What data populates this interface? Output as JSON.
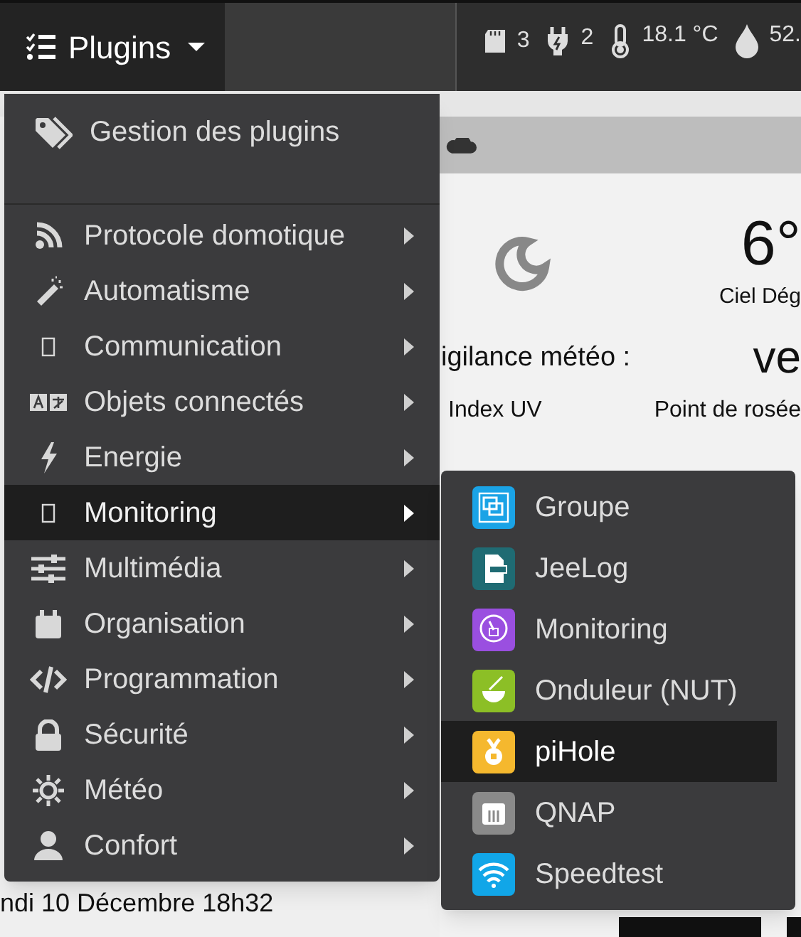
{
  "topbar": {
    "plugins_button": {
      "label": "Plugins"
    },
    "status": [
      {
        "value": "3"
      },
      {
        "value": "2"
      },
      {
        "value": "18.1 °C"
      },
      {
        "value": "52."
      }
    ]
  },
  "weather": {
    "temperature": "6°",
    "condition": "Ciel Dég",
    "vigilance_label": "igilance météo :",
    "vigilance_value": "ve",
    "columns": [
      "Index UV",
      "Point de rosée"
    ]
  },
  "footer_text": "ndi 10 Décembre 18h32",
  "menu": {
    "header": {
      "label": "Gestion des plugins"
    },
    "items": [
      {
        "label": "Protocole domotique",
        "selected": false
      },
      {
        "label": "Automatisme",
        "selected": false
      },
      {
        "label": "Communication",
        "selected": false
      },
      {
        "label": "Objets connectés",
        "selected": false
      },
      {
        "label": "Energie",
        "selected": false
      },
      {
        "label": "Monitoring",
        "selected": true
      },
      {
        "label": "Multimédia",
        "selected": false
      },
      {
        "label": "Organisation",
        "selected": false
      },
      {
        "label": "Programmation",
        "selected": false
      },
      {
        "label": "Sécurité",
        "selected": false
      },
      {
        "label": "Météo",
        "selected": false
      },
      {
        "label": "Confort",
        "selected": false
      }
    ]
  },
  "submenu": {
    "items": [
      {
        "label": "Groupe",
        "color": "#1aa3e6",
        "selected": false
      },
      {
        "label": "JeeLog",
        "color": "#1f6b73",
        "selected": false
      },
      {
        "label": "Monitoring",
        "color": "#9a4fe0",
        "selected": false
      },
      {
        "label": "Onduleur (NUT)",
        "color": "#8cbf26",
        "selected": false
      },
      {
        "label": "piHole",
        "color": "#f5b82e",
        "selected": true
      },
      {
        "label": "QNAP",
        "color": "#8a8a8a",
        "selected": false
      },
      {
        "label": "Speedtest",
        "color": "#11a6e8",
        "selected": false
      }
    ]
  }
}
